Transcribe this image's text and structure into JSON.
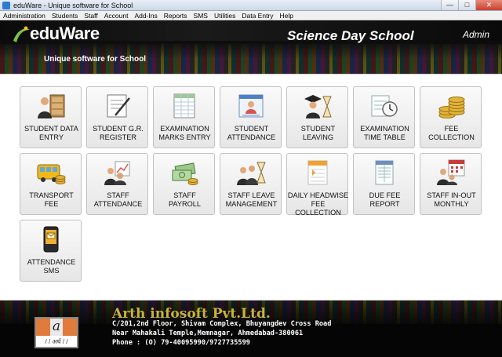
{
  "window": {
    "title": "eduWare - Unique software for School",
    "minimize": "—",
    "maximize": "□",
    "close": "✕"
  },
  "menu": [
    "Administration",
    "Students",
    "Staff",
    "Account",
    "Add-Ins",
    "Reports",
    "SMS",
    "Utilities",
    "Data Entry",
    "Help"
  ],
  "header": {
    "brand": "eduWare",
    "tagline": "Unique software for School",
    "school_name": "Science Day School",
    "user": "Admin"
  },
  "tiles": [
    {
      "label": "STUDENT DATA\nENTRY",
      "icon": "student-data-entry-icon"
    },
    {
      "label": "STUDENT G.R.\nREGISTER",
      "icon": "gr-register-icon"
    },
    {
      "label": "EXAMINATION\nMARKS ENTRY",
      "icon": "marks-entry-icon"
    },
    {
      "label": "STUDENT\nATTENDANCE",
      "icon": "student-attendance-icon"
    },
    {
      "label": "STUDENT\nLEAVING",
      "icon": "student-leaving-icon"
    },
    {
      "label": "EXAMINATION\nTIME TABLE",
      "icon": "time-table-icon"
    },
    {
      "label": "FEE\nCOLLECTION",
      "icon": "coins-icon"
    },
    {
      "label": "TRANSPORT\nFEE",
      "icon": "bus-icon"
    },
    {
      "label": "STAFF\nATTENDANCE",
      "icon": "staff-attendance-icon"
    },
    {
      "label": "STAFF\nPAYROLL",
      "icon": "payroll-icon"
    },
    {
      "label": "STAFF LEAVE\nMANAGEMENT",
      "icon": "staff-leave-icon"
    },
    {
      "label": "DAILY HEADWISE\nFEE COLLECTION",
      "icon": "headwise-fee-icon"
    },
    {
      "label": "DUE FEE\nREPORT",
      "icon": "due-fee-report-icon"
    },
    {
      "label": "STAFF IN-OUT\nMONTHLY",
      "icon": "staff-in-out-icon"
    },
    {
      "label": "ATTENDANCE\nSMS",
      "icon": "sms-phone-icon"
    }
  ],
  "footer": {
    "logo_letter": "a",
    "logo_sub": "/ / अर्थ / /",
    "company": "Arth infosoft Pvt.Ltd.",
    "address_line1": "C/201,2nd Floor, Shivam Complex, Bhuyangdev Cross Road",
    "address_line2": "Near Mahakali Temple,Memnagar, Ahmedabad-380061",
    "phone": "Phone : (O) 79-40095990/9727735599"
  },
  "colors": {
    "company": "#c7b43a",
    "logo_orange": "#e07b3c"
  }
}
